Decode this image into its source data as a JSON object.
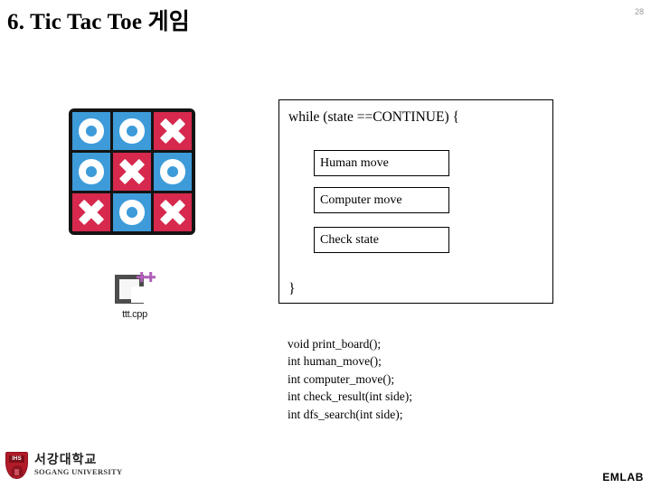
{
  "slide": {
    "title": "6. Tic Tac Toe 게임",
    "page_number": "28"
  },
  "board": {
    "caption": "tic-tac-toe-board",
    "colors": {
      "blue_cell": "#3d9bd9",
      "red_cell": "#d6294d",
      "mark": "#ffffff",
      "grid": "#141414"
    },
    "cells": [
      {
        "mark": "O",
        "color": "blue"
      },
      {
        "mark": "O",
        "color": "blue"
      },
      {
        "mark": "X",
        "color": "red"
      },
      {
        "mark": "O",
        "color": "blue"
      },
      {
        "mark": "X",
        "color": "red"
      },
      {
        "mark": "O",
        "color": "blue"
      },
      {
        "mark": "X",
        "color": "red"
      },
      {
        "mark": "O",
        "color": "blue"
      },
      {
        "mark": "X",
        "color": "red"
      }
    ]
  },
  "file_icon": {
    "label": "ttt.cpp",
    "icon": "cpp-file-icon",
    "plus_color": "#b060b8",
    "bracket_color": "#4d4d4d"
  },
  "loop_box": {
    "header": "while (state ==CONTINUE) {",
    "footer": "}",
    "steps": [
      {
        "label": "Human move"
      },
      {
        "label": "Computer move"
      },
      {
        "label": "Check state"
      }
    ]
  },
  "prototypes": {
    "lines": [
      "void print_board();",
      "int human_move();",
      "int computer_move();",
      "int check_result(int side);",
      "int dfs_search(int side);"
    ]
  },
  "footer": {
    "university_kr": "서강대학교",
    "university_en": "SOGANG UNIVERSITY",
    "crest_text": "IHS",
    "crest_color": "#b31b28",
    "lab": "EMLAB"
  }
}
